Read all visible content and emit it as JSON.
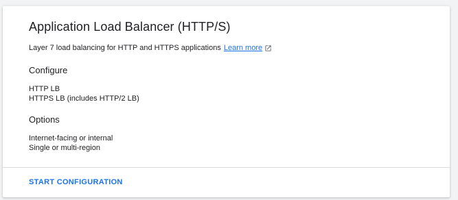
{
  "card": {
    "title": "Application Load Balancer (HTTP/S)",
    "description": "Layer 7 load balancing for HTTP and HTTPS applications",
    "learn_more": "Learn more",
    "link_icon": "open-in-new-icon",
    "configure": {
      "heading": "Configure",
      "items": [
        "HTTP LB",
        "HTTPS LB (includes HTTP/2 LB)"
      ]
    },
    "options": {
      "heading": "Options",
      "items": [
        "Internet-facing or internal",
        "Single or multi-region"
      ]
    },
    "action_label": "START CONFIGURATION"
  },
  "colors": {
    "accent": "#1a73e8",
    "text": "#202124",
    "divider": "#dadce0"
  }
}
